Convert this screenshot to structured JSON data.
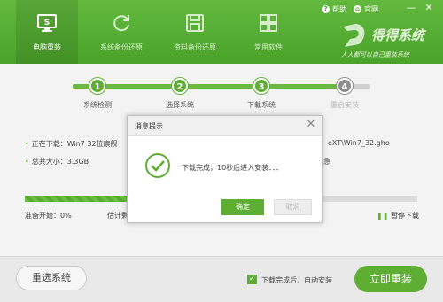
{
  "header": {
    "tabs": [
      {
        "label": "电脑重装",
        "icon": "monitor-icon"
      },
      {
        "label": "系统备份还原",
        "icon": "refresh-icon"
      },
      {
        "label": "资料备份还原",
        "icon": "save-icon"
      },
      {
        "label": "常用软件",
        "icon": "grid-icon"
      }
    ],
    "help_label": "帮助",
    "site_label": "官网",
    "brand_name": "得得系统",
    "brand_slogan": "人人都可以自己重装系统"
  },
  "steps": [
    {
      "number": "1",
      "label": "系统检测",
      "done": true
    },
    {
      "number": "2",
      "label": "选择系统",
      "done": true
    },
    {
      "number": "3",
      "label": "下载系统",
      "done": true
    },
    {
      "number": "4",
      "label": "重启安装",
      "done": false
    }
  ],
  "download": {
    "current_prefix": "正在下载：Win7 32位旗舰",
    "path_suffix": "eXT\\Win7_32.gho",
    "total_prefix": "总共大小：3.3GB",
    "total_suffix": "急",
    "prep_label": "准备开始：0%",
    "estimate_label": "估计剩",
    "pause_label": "暂停下载",
    "progress_percent": 27
  },
  "dialog": {
    "title": "消息提示",
    "message": "下载完成，10秒后进入安装．．．",
    "ok_label": "确定",
    "cancel_label": "取消"
  },
  "footer": {
    "reselect_label": "重选系统",
    "auto_install_label": "下载完成后，自动安装",
    "auto_install_checked": true,
    "install_label": "立即重装"
  },
  "colors": {
    "accent": "#5fae34",
    "header": "#4aa22a"
  }
}
